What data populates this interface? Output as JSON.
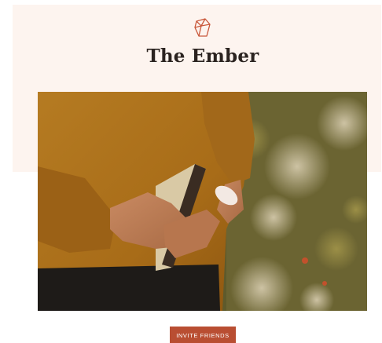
{
  "header": {
    "logo_icon": "gem-icon",
    "title": "The Ember"
  },
  "hero_image": {
    "subject": "photo"
  },
  "cta": {
    "label": "INVITE FRIENDS"
  },
  "colors": {
    "band": "#fdf4ef",
    "accent": "#b94e32",
    "title": "#2b2320"
  }
}
